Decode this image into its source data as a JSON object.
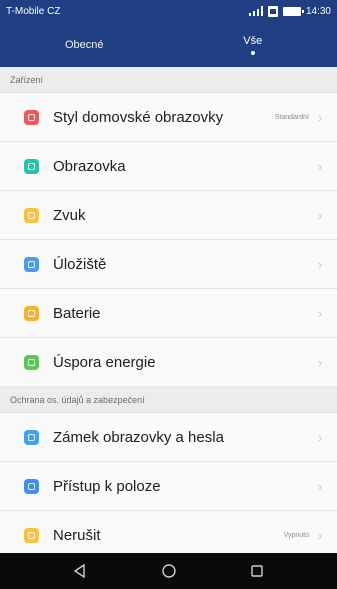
{
  "status_bar": {
    "carrier": "T-Mobile CZ",
    "time": "14:30",
    "bar_color": "#1f3f82"
  },
  "tabs": [
    {
      "label": "Obecné",
      "active": false
    },
    {
      "label": "Vše",
      "active": true
    }
  ],
  "sections": [
    {
      "header": "Zařízení",
      "items": [
        {
          "label": "Styl domovské obrazovky",
          "value": "Standardní",
          "icon": "home-style-icon",
          "color": "#f0565a"
        },
        {
          "label": "Obrazovka",
          "value": "",
          "icon": "display-icon",
          "color": "#27c2a8"
        },
        {
          "label": "Zvuk",
          "value": "",
          "icon": "sound-icon",
          "color": "#f7c33a"
        },
        {
          "label": "Úložiště",
          "value": "",
          "icon": "storage-icon",
          "color": "#4a9bf0"
        },
        {
          "label": "Baterie",
          "value": "",
          "icon": "battery-icon",
          "color": "#f6b42e"
        },
        {
          "label": "Úspora energie",
          "value": "",
          "icon": "power-saving-icon",
          "color": "#5cc65a"
        }
      ]
    },
    {
      "header": "Ochrana os. údajů a zabezpečení",
      "items": [
        {
          "label": "Zámek obrazovky a hesla",
          "value": "",
          "icon": "lock-icon",
          "color": "#3fa2f0"
        },
        {
          "label": "Přístup k poloze",
          "value": "",
          "icon": "location-icon",
          "color": "#3f8ef0"
        },
        {
          "label": "Nerušit",
          "value": "Vypnuto",
          "icon": "do-not-disturb-icon",
          "color": "#f7c33a"
        }
      ]
    }
  ]
}
